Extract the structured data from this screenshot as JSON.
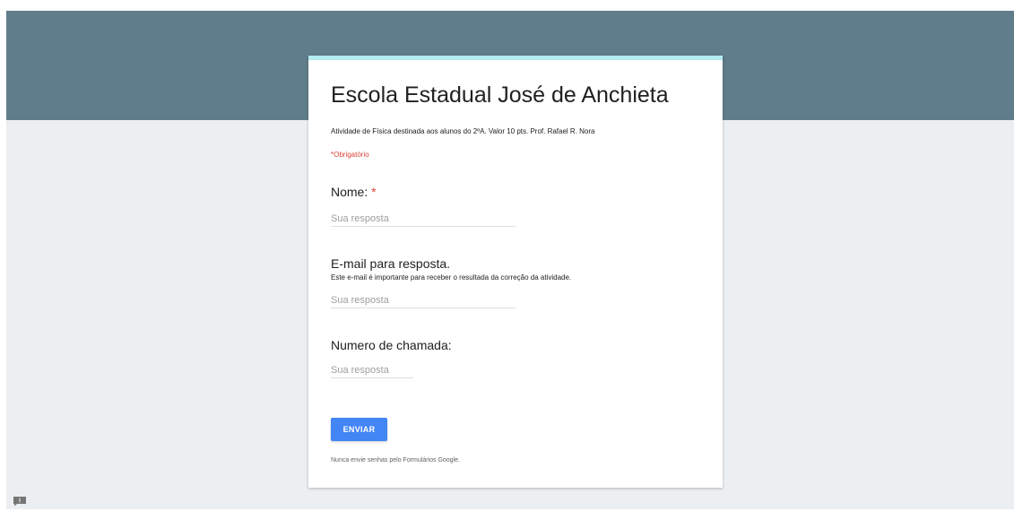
{
  "form": {
    "title": "Escola Estadual José de Anchieta",
    "description": "Atividade de Física destinada aos alunos do 2ºA. Valor 10 pts. Prof. Rafael R. Nora",
    "required_note": "*Obrigatório",
    "questions": [
      {
        "label": "Nome:",
        "required_mark": "*",
        "placeholder": "Sua resposta",
        "value": ""
      },
      {
        "label": "E-mail para resposta.",
        "help": "Este e-mail é importante para receber o resultada da correção da atividade.",
        "placeholder": "Sua resposta",
        "value": ""
      },
      {
        "label": "Numero de chamada:",
        "placeholder": "Sua resposta",
        "value": ""
      }
    ],
    "submit_label": "ENVIAR",
    "footer_note": "Nunca envie senhas pelo Formulários Google."
  },
  "feedback": {
    "icon": "report-feedback-icon",
    "glyph": "!"
  },
  "colors": {
    "header_band": "#607d8b",
    "page_background": "#eceff1",
    "card_accent": "#b2ebf2",
    "button": "#4285f4",
    "required": "#db4437"
  }
}
